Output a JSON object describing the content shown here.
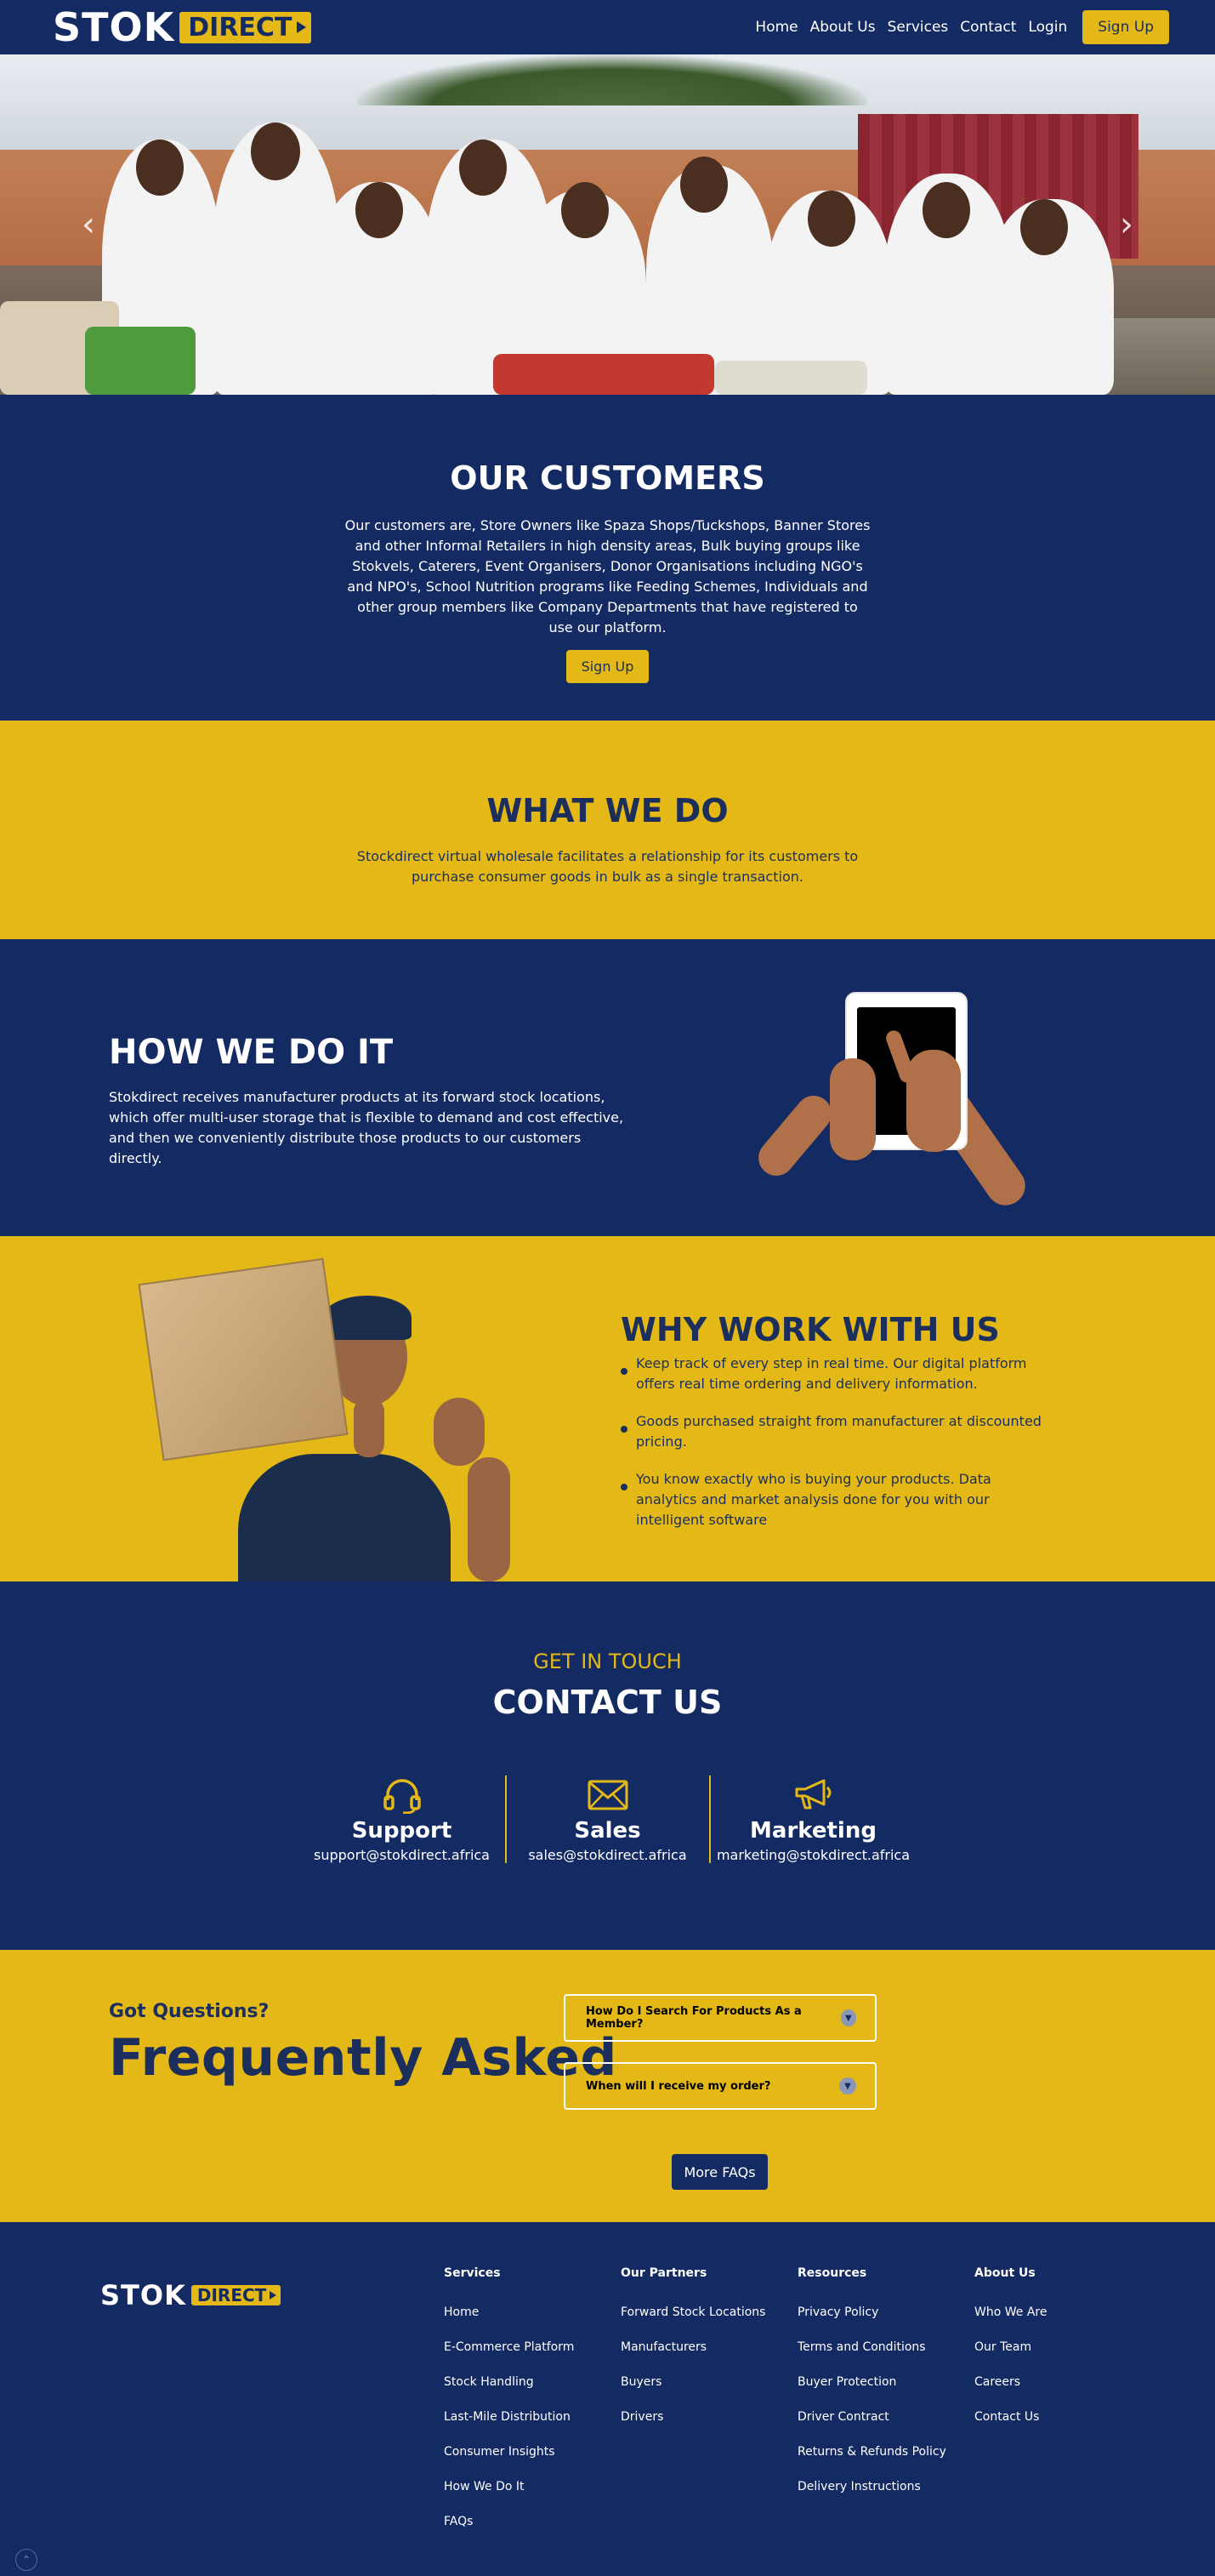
{
  "colors": {
    "navy": "#132a62",
    "gold": "#e3b817",
    "text_navy": "#1c2f5c"
  },
  "header": {
    "logo_stok": "STOK",
    "logo_direct": "DIRECT",
    "nav": [
      "Home",
      "About Us",
      "Services",
      "Contact",
      "Login"
    ],
    "signup_label": "Sign Up"
  },
  "hero": {
    "prev_icon": "chevron-left-icon",
    "next_icon": "chevron-right-icon"
  },
  "customers": {
    "title": "OUR CUSTOMERS",
    "text": "Our customers are, Store Owners like Spaza Shops/Tuckshops, Banner Stores and other Informal Retailers in high density areas, Bulk buying groups like Stokvels, Caterers, Event Organisers, Donor Organisations including NGO's and NPO's, School Nutrition programs like Feeding Schemes, Individuals and other group members like Company Departments that have registered to use our platform.",
    "button": "Sign Up"
  },
  "whatwedo": {
    "title": "WHAT WE DO",
    "text": "Stockdirect virtual wholesale facilitates a relationship for its customers to purchase consumer goods in bulk as a single transaction."
  },
  "howwedo": {
    "title": "HOW WE DO IT",
    "text": "Stokdirect receives manufacturer products at its forward stock locations, which offer multi-user storage that is flexible to demand and cost effective, and then we conveniently distribute those products to our customers directly."
  },
  "whywork": {
    "title": "WHY WORK WITH US",
    "items": [
      "Keep track of every step in real time. Our digital platform offers real time ordering and delivery information.",
      "Goods purchased straight from manufacturer at discounted pricing.",
      "You know exactly who is buying your products. Data analytics and market analysis done for you with our intelligent software"
    ]
  },
  "contact": {
    "eyebrow": "GET IN TOUCH",
    "title": "CONTACT US",
    "cards": [
      {
        "icon": "headset-icon",
        "label": "Support",
        "email": "support@stokdirect.africa"
      },
      {
        "icon": "envelope-icon",
        "label": "Sales",
        "email": "sales@stokdirect.africa"
      },
      {
        "icon": "megaphone-icon",
        "label": "Marketing",
        "email": "marketing@stokdirect.africa"
      }
    ]
  },
  "faq": {
    "eyebrow": "Got Questions?",
    "title": "Frequently Asked",
    "questions": [
      "How Do I Search For Products As a Member?",
      "When will I receive my order?"
    ],
    "more_button": "More FAQs"
  },
  "footer": {
    "logo_stok": "STOK",
    "logo_direct": "DIRECT",
    "columns": [
      {
        "title": "Services",
        "links": [
          "Home",
          "E-Commerce Platform",
          "Stock Handling",
          "Last-Mile Distribution",
          "Consumer Insights",
          "How We Do It",
          "FAQs"
        ]
      },
      {
        "title": "Our Partners",
        "links": [
          "Forward Stock Locations",
          "Manufacturers",
          "Buyers",
          "Drivers"
        ]
      },
      {
        "title": "Resources",
        "links": [
          "Privacy Policy",
          "Terms and Conditions",
          "Buyer Protection",
          "Driver Contract",
          "Returns & Refunds Policy",
          "Delivery Instructions"
        ]
      },
      {
        "title": "About Us",
        "links": [
          "Who We Are",
          "Our Team",
          "Careers",
          "Contact Us"
        ]
      }
    ],
    "back_to_top_icon": "chevron-up-icon"
  }
}
